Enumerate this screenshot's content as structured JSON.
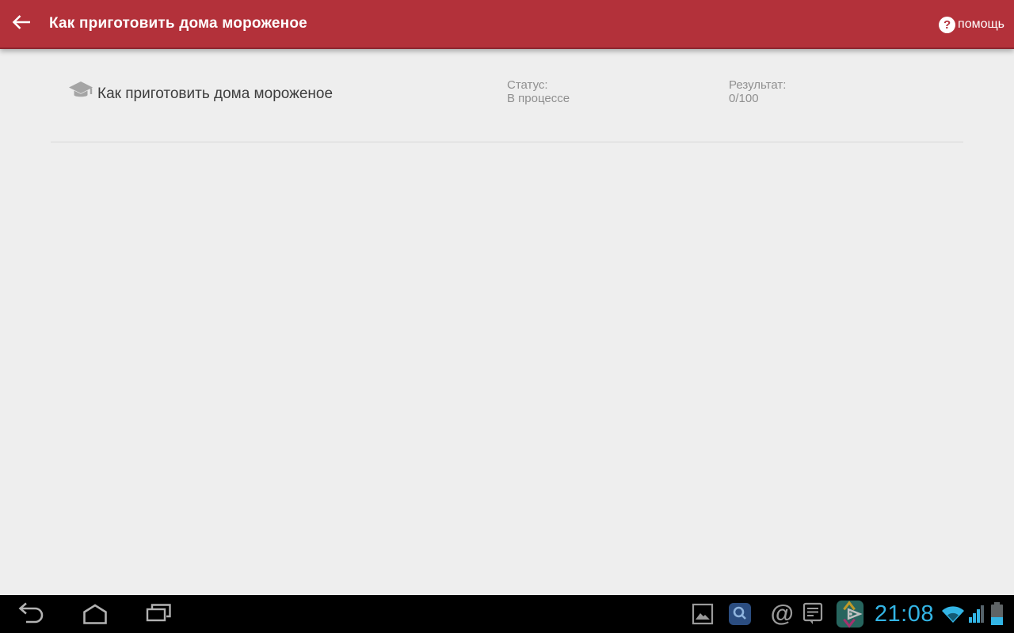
{
  "app_bar": {
    "title": "Как приготовить дома мороженое",
    "back_icon": "arrow-left",
    "help": {
      "icon_glyph": "?",
      "label": "помощь"
    },
    "bg_color": "#b3313a"
  },
  "content": {
    "course_item": {
      "icon": "graduation-cap",
      "title": "Как приготовить дома мороженое",
      "status_label": "Статус:",
      "status_value": "В процессе",
      "result_label": "Результат:",
      "result_value": "0/100"
    }
  },
  "nav_bar": {
    "time": "21:08",
    "email_glyph": "@"
  },
  "colors": {
    "accent_red": "#b3313a",
    "holo_blue": "#33b5e5",
    "content_bg": "#eeeeee",
    "secondary_text": "#8f8f8f",
    "nav_icon_gray": "#b2b2b2"
  }
}
